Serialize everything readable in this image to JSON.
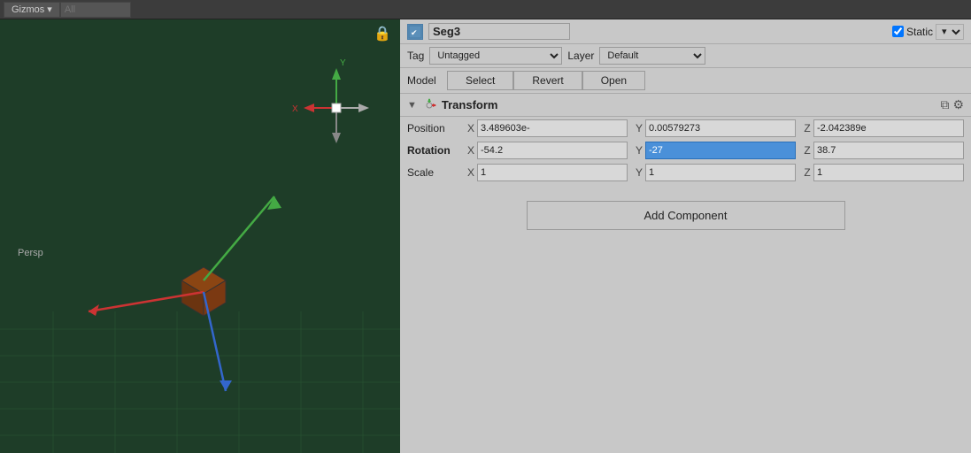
{
  "toolbar": {
    "gizmos_label": "Gizmos",
    "search_placeholder": "All"
  },
  "inspector": {
    "object_name": "Seg3",
    "static_label": "Static",
    "tag_label": "Tag",
    "tag_value": "Untagged",
    "layer_label": "Layer",
    "layer_value": "Default",
    "model_label": "Model",
    "model_select_btn": "Select",
    "model_revert_btn": "Revert",
    "model_open_btn": "Open",
    "transform": {
      "title": "Transform",
      "position_label": "Position",
      "position_x": "3.489603e-",
      "position_y": "0.00579273",
      "position_z": "-2.042389e",
      "rotation_label": "Rotation",
      "rotation_x": "-54.2",
      "rotation_y": "-27",
      "rotation_z": "38.7",
      "scale_label": "Scale",
      "scale_x": "1",
      "scale_y": "1",
      "scale_z": "1"
    },
    "add_component_label": "Add Component"
  },
  "viewport": {
    "persp_label": "Persp"
  },
  "axis_labels": {
    "x": "X",
    "y": "Y",
    "z": "Z"
  }
}
